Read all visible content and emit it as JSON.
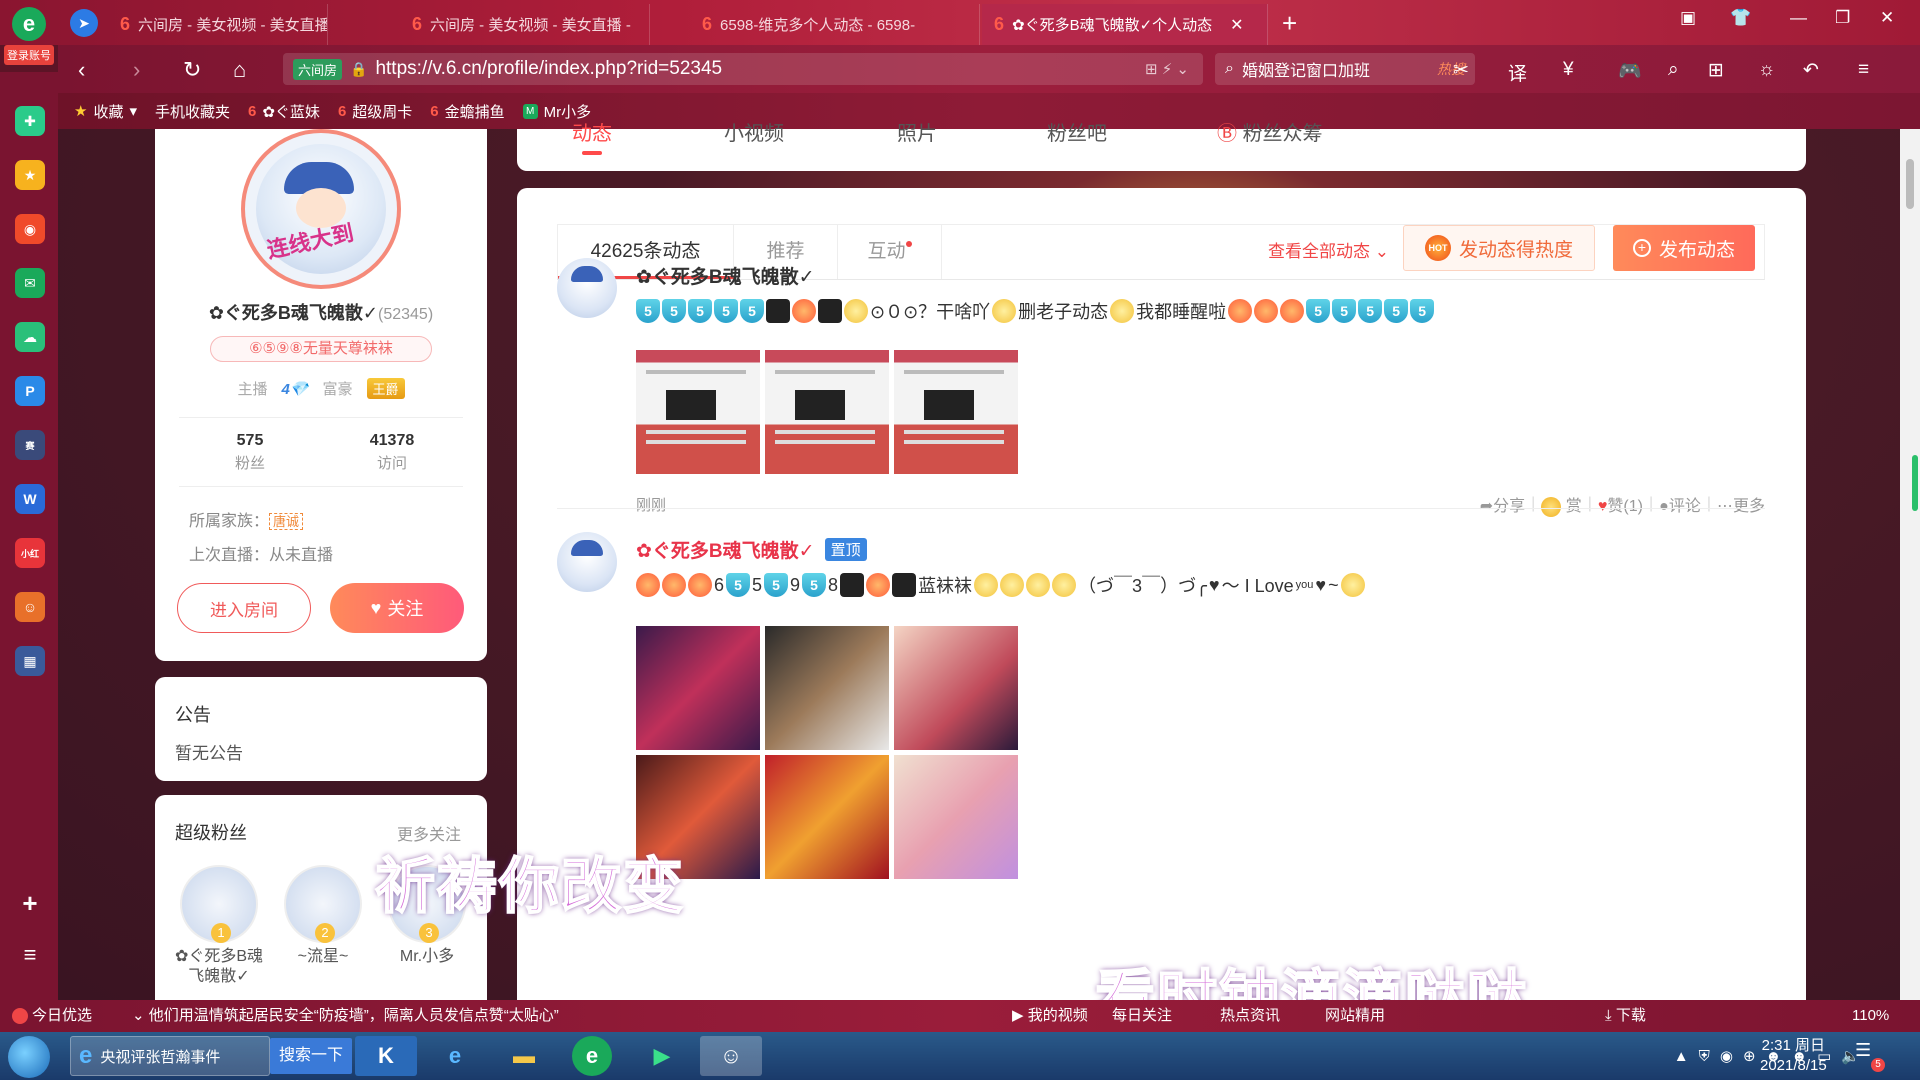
{
  "browser": {
    "login_label": "登录账号",
    "tabs": [
      {
        "label": "六间房 - 美女视频 - 美女直播",
        "active": false
      },
      {
        "label": "六间房 - 美女视频 - 美女直播 -",
        "active": false
      },
      {
        "label": "6598-维克多个人动态 - 6598-",
        "active": false
      },
      {
        "label": "✿ぐ死多B魂飞魄散✓个人动态",
        "active": true
      }
    ],
    "url": "https://v.6.cn/profile/index.php?rid=52345",
    "site_badge": "六间房",
    "search_text": "婚姻登记窗口加班",
    "search_hot": "热搜",
    "bookmarks": [
      "收藏",
      "手机收藏夹",
      "✿ぐ蓝妹",
      "超级周卡",
      "金蟾捕鱼",
      "Mr小多"
    ]
  },
  "profile": {
    "name": "✿ぐ死多B魂飞魄散✓",
    "rid": "(52345)",
    "fan_badge": "⑥⑤⑨⑧无量天尊袜袜",
    "anchor_label": "主播",
    "anchor_level": "4",
    "rich_label": "富豪",
    "rich_title": "王爵",
    "fans_count": "575",
    "fans_label": "粉丝",
    "visits_count": "41378",
    "visits_label": "访问",
    "family_label": "所属家族：",
    "family_tag": "唐诚",
    "last_live": "上次直播：从未直播",
    "enter_room": "进入房间",
    "follow": "关注",
    "avatar_text": "连线大到"
  },
  "notice": {
    "title": "公告",
    "content": "暂无公告"
  },
  "super_fans": {
    "title": "超级粉丝",
    "more": "更多关注",
    "fans": [
      {
        "rank": "1",
        "name": "✿ぐ死多B魂飞魄散✓"
      },
      {
        "rank": "2",
        "name": "~流星~"
      },
      {
        "rank": "3",
        "name": "Mr.小多"
      }
    ]
  },
  "topnav": {
    "items": [
      "动态",
      "小视频",
      "照片",
      "粉丝吧",
      "粉丝众筹"
    ],
    "active": "动态"
  },
  "feed": {
    "tabs": [
      "42625条动态",
      "推荐",
      "互动"
    ],
    "view_all": "查看全部动态",
    "hot_button": "发动态得热度",
    "hot_icon_text": "HOT",
    "post_button": "发布动态"
  },
  "posts": [
    {
      "author": "✿ぐ死多B魂飞魄散✓",
      "text_a": "⊙０⊙？干啥吖",
      "text_b": "删老子动态",
      "text_c": "我都睡醒啦",
      "time": "刚刚",
      "actions": {
        "share": "分享",
        "reward": "赏",
        "like": "赞(1)",
        "comment": "评论",
        "more": "更多"
      }
    },
    {
      "author": "✿ぐ死多B魂飞魄散✓",
      "pinned": "置顶",
      "text_nums": [
        "6",
        "5",
        "9",
        "8"
      ],
      "text_a": "蓝袜袜",
      "text_b": "（づ￣3￣）づ╭",
      "text_c": "～ I Love",
      "text_sub": "you",
      "text_d": "~"
    }
  ],
  "overlays": {
    "caption1": "祈祷你改变",
    "caption2": "看时钟滴滴哒哒"
  },
  "statusbar": {
    "today": "今日优选",
    "news": "他们用温情筑起居民安全“防疫墙”，隔离人员发信点赞“太贴心”",
    "my_video": "我的视频",
    "daily_follow": "每日关注",
    "hot_news": "热点资讯",
    "site_apps": "网站精用",
    "download": "下载",
    "zoom": "110%"
  },
  "taskbar": {
    "ie_label": "央视评张哲瀚事件",
    "search_btn": "搜索一下",
    "time": "2:31 周日",
    "date": "2021/8/15",
    "notif_count": "5"
  }
}
